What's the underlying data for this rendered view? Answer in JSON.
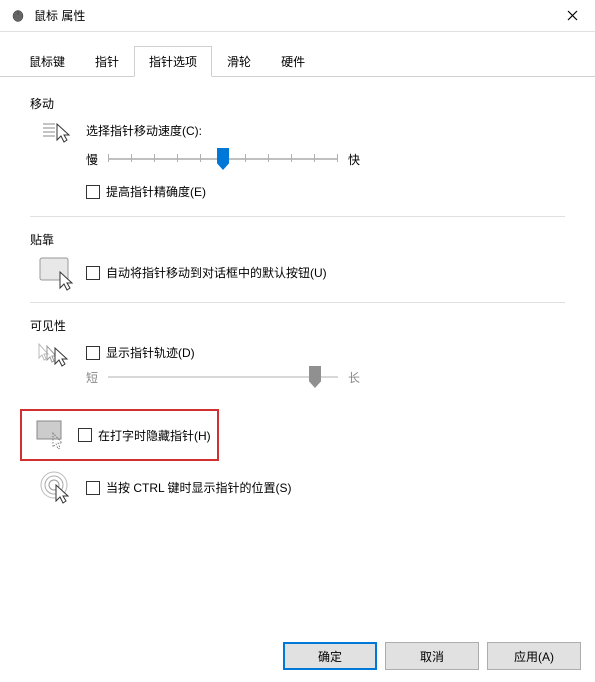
{
  "window": {
    "title": "鼠标 属性",
    "close": "×"
  },
  "tabs": {
    "items": [
      "鼠标键",
      "指针",
      "指针选项",
      "滑轮",
      "硬件"
    ],
    "active_index": 2
  },
  "motion": {
    "group_label": "移动",
    "speed_label": "选择指针移动速度(C):",
    "slow": "慢",
    "fast": "快",
    "speed_value": 5,
    "speed_max": 10,
    "precision_label": "提高指针精确度(E)",
    "precision_checked": false
  },
  "snap": {
    "group_label": "贴靠",
    "snap_label": "自动将指针移动到对话框中的默认按钮(U)",
    "snap_checked": false
  },
  "visibility": {
    "group_label": "可见性",
    "trails_label": "显示指针轨迹(D)",
    "trails_checked": false,
    "short": "短",
    "long": "长",
    "trails_value": 9,
    "trails_max": 10,
    "hide_label": "在打字时隐藏指针(H)",
    "hide_checked": false,
    "ctrl_label": "当按 CTRL 键时显示指针的位置(S)",
    "ctrl_checked": false
  },
  "buttons": {
    "ok": "确定",
    "cancel": "取消",
    "apply": "应用(A)"
  }
}
